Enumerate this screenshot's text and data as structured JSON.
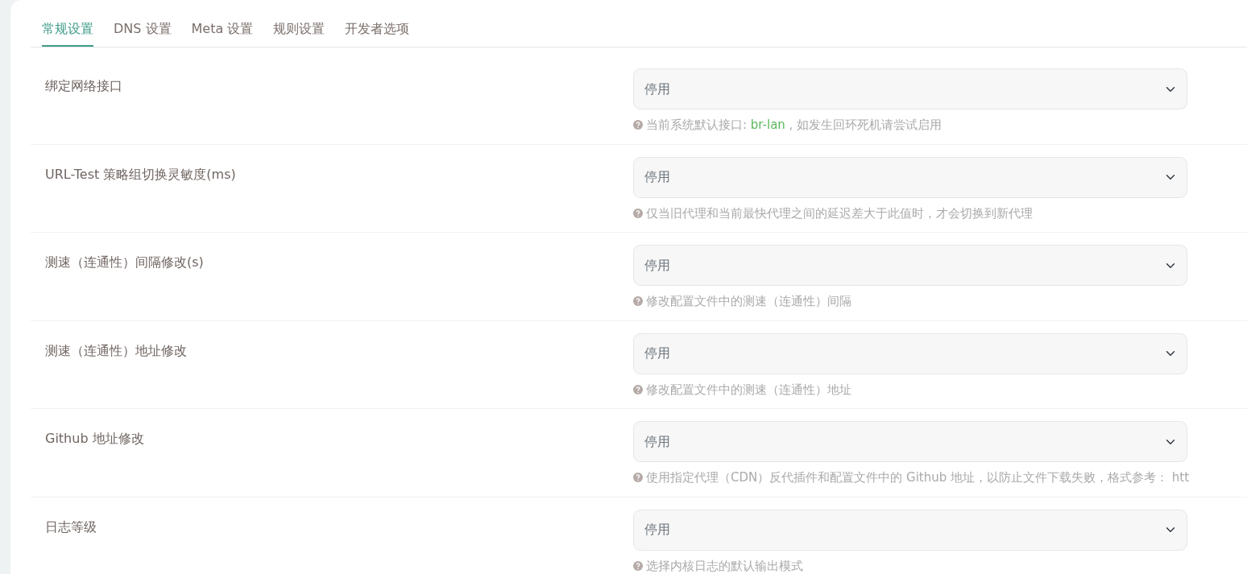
{
  "tabs": [
    {
      "label": "常规设置",
      "selected": true
    },
    {
      "label": "DNS 设置",
      "selected": false
    },
    {
      "label": "Meta 设置",
      "selected": false
    },
    {
      "label": "规则设置",
      "selected": false
    },
    {
      "label": "开发者选项",
      "selected": false
    }
  ],
  "settings": [
    {
      "label": "绑定网络接口",
      "value": "停用",
      "hint": [
        {
          "kind": "text",
          "text": "当前系统默认接口: "
        },
        {
          "kind": "code",
          "text": "br-lan"
        },
        {
          "kind": "text",
          "text": " , 如发生回环死机请尝试启用"
        }
      ]
    },
    {
      "label": "URL-Test 策略组切换灵敏度(ms)",
      "value": "停用",
      "hint": [
        {
          "kind": "text",
          "text": "仅当旧代理和当前最快代理之间的延迟差大于此值时，才会切换到新代理"
        }
      ]
    },
    {
      "label": "测速（连通性）间隔修改(s)",
      "value": "停用",
      "hint": [
        {
          "kind": "text",
          "text": "修改配置文件中的测速（连通性）间隔"
        }
      ]
    },
    {
      "label": "测速（连通性）地址修改",
      "value": "停用",
      "hint": [
        {
          "kind": "text",
          "text": "修改配置文件中的测速（连通性）地址"
        }
      ]
    },
    {
      "label": "Github 地址修改",
      "value": "停用",
      "hint": [
        {
          "kind": "text",
          "text": "使用指定代理（CDN）反代插件和配置文件中的 Github 地址，以防止文件下载失败，格式参考： htt"
        }
      ]
    },
    {
      "label": "日志等级",
      "value": "停用",
      "hint": [
        {
          "kind": "text",
          "text": "选择内核日志的默认输出模式"
        }
      ]
    }
  ]
}
